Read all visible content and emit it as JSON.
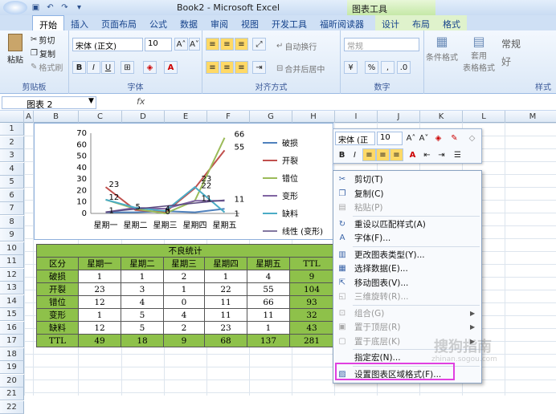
{
  "window": {
    "title": "Book2 - Microsoft Excel",
    "context_tab_group": "图表工具"
  },
  "tabs": [
    "开始",
    "插入",
    "页面布局",
    "公式",
    "数据",
    "审阅",
    "视图",
    "开发工具",
    "福昕阅读器"
  ],
  "context_tabs": [
    "设计",
    "布局",
    "格式"
  ],
  "ribbon": {
    "clipboard": {
      "paste": "粘贴",
      "cut": "剪切",
      "copy": "复制",
      "format_painter": "格式刷",
      "label": "剪贴板"
    },
    "font": {
      "name": "宋体 (正文)",
      "size": "10",
      "label": "字体",
      "bold": "B",
      "italic": "I",
      "underline": "U"
    },
    "alignment": {
      "wrap": "自动换行",
      "merge": "合并后居中",
      "label": "对齐方式"
    },
    "number": {
      "format": "常规",
      "label": "数字"
    },
    "styles": {
      "conditional": "条件格式",
      "table_line1": "套用",
      "table_line2": "表格格式",
      "normal": "常规",
      "good": "好",
      "label": "样式"
    }
  },
  "formula_bar": {
    "name_box": "图表 2",
    "fx": "fx"
  },
  "columns": [
    "A",
    "B",
    "C",
    "D",
    "E",
    "F",
    "G",
    "H",
    "I",
    "J",
    "K",
    "L",
    "M"
  ],
  "rows": [
    "1",
    "2",
    "3",
    "4",
    "5",
    "6",
    "7",
    "8",
    "9",
    "10",
    "11",
    "12",
    "13",
    "14",
    "15",
    "16",
    "17",
    "18",
    "19",
    "20",
    "21",
    "22"
  ],
  "table": {
    "title": "不良统计",
    "header": [
      "区分",
      "星期一",
      "星期二",
      "星期三",
      "星期四",
      "星期五",
      "TTL"
    ],
    "rows": [
      [
        "破损",
        "1",
        "1",
        "2",
        "1",
        "4",
        "9"
      ],
      [
        "开裂",
        "23",
        "3",
        "1",
        "22",
        "55",
        "104"
      ],
      [
        "错位",
        "12",
        "4",
        "0",
        "11",
        "66",
        "93"
      ],
      [
        "变形",
        "1",
        "5",
        "4",
        "11",
        "11",
        "32"
      ],
      [
        "缺料",
        "12",
        "5",
        "2",
        "23",
        "1",
        "43"
      ],
      [
        "TTL",
        "49",
        "18",
        "9",
        "68",
        "137",
        "281"
      ]
    ]
  },
  "chart_data": {
    "type": "line",
    "categories": [
      "星期一",
      "星期二",
      "星期三",
      "星期四",
      "星期五"
    ],
    "ylim": [
      0,
      70
    ],
    "yticks": [
      0,
      10,
      20,
      30,
      40,
      50,
      60,
      70
    ],
    "series": [
      {
        "name": "破损",
        "color": "#4f81bd",
        "values": [
          1,
          1,
          2,
          1,
          4
        ]
      },
      {
        "name": "开裂",
        "color": "#c0504d",
        "values": [
          23,
          3,
          1,
          22,
          55
        ]
      },
      {
        "name": "错位",
        "color": "#9bbb59",
        "values": [
          12,
          4,
          0,
          11,
          66
        ]
      },
      {
        "name": "变形",
        "color": "#8064a2",
        "values": [
          1,
          5,
          4,
          11,
          11
        ]
      },
      {
        "name": "缺料",
        "color": "#4bacc6",
        "values": [
          12,
          5,
          2,
          23,
          1
        ]
      }
    ],
    "trendline": {
      "name": "线性 (变形)"
    },
    "data_labels": [
      "23",
      "12",
      "1",
      "66",
      "55",
      "22",
      "23",
      "11",
      "11",
      "1",
      "5",
      "4",
      "0"
    ],
    "legend_position": "right"
  },
  "mini_toolbar": {
    "font": "宋体 (正",
    "size": "10",
    "bold": "B",
    "italic": "I"
  },
  "context_menu": [
    {
      "label": "剪切(T)",
      "icon": "cut-icon",
      "disabled": false
    },
    {
      "label": "复制(C)",
      "icon": "copy-icon",
      "disabled": false
    },
    {
      "label": "粘贴(P)",
      "icon": "paste-icon",
      "disabled": true
    },
    {
      "label": "重设以匹配样式(A)",
      "icon": "reset-style-icon",
      "disabled": false,
      "sep_before": true
    },
    {
      "label": "字体(F)...",
      "icon": "font-icon",
      "disabled": false
    },
    {
      "label": "更改图表类型(Y)...",
      "icon": "chart-type-icon",
      "disabled": false,
      "sep_before": true
    },
    {
      "label": "选择数据(E)...",
      "icon": "select-data-icon",
      "disabled": false
    },
    {
      "label": "移动图表(V)...",
      "icon": "move-chart-icon",
      "disabled": false
    },
    {
      "label": "三维旋转(R)...",
      "icon": "rotate-3d-icon",
      "disabled": true
    },
    {
      "label": "组合(G)",
      "icon": "group-icon",
      "disabled": true,
      "submenu": true,
      "sep_before": true
    },
    {
      "label": "置于顶层(R)",
      "icon": "bring-front-icon",
      "disabled": true,
      "submenu": true
    },
    {
      "label": "置于底层(K)",
      "icon": "send-back-icon",
      "disabled": true,
      "submenu": true
    },
    {
      "label": "指定宏(N)...",
      "icon": "macro-icon",
      "disabled": false,
      "sep_before": true
    },
    {
      "label": "设置图表区域格式(F)...",
      "icon": "format-chart-area-icon",
      "disabled": false,
      "sep_before": true
    }
  ],
  "watermark": {
    "text": "搜狗指南",
    "sub": "zhinan.sogou.com"
  }
}
